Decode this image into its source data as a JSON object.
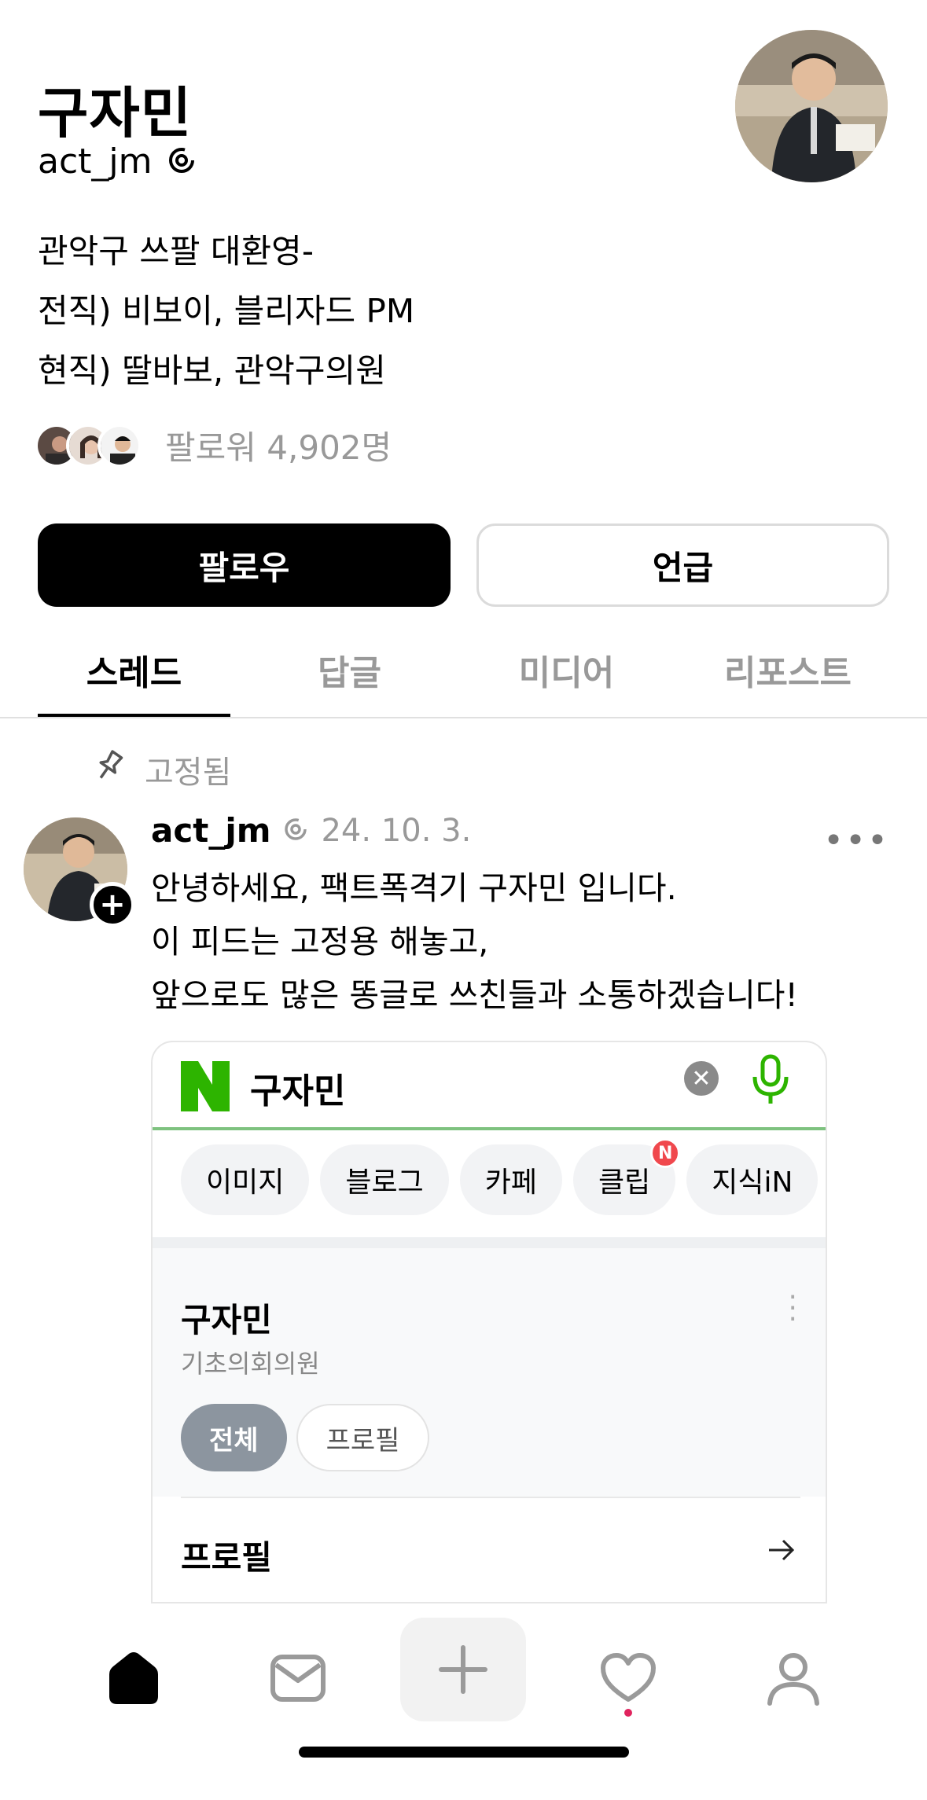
{
  "profile": {
    "name": "구자민",
    "handle": "act_jm",
    "bio": [
      "관악구 쓰팔 대환영-",
      "전직) 비보이, 블리자드 PM",
      "현직) 딸바보, 관악구의원"
    ],
    "followers_text": "팔로워 4,902명",
    "follow_label": "팔로우",
    "mention_label": "언급"
  },
  "tabs": [
    "스레드",
    "답글",
    "미디어",
    "리포스트"
  ],
  "post": {
    "pinned_label": "고정됨",
    "handle": "act_jm",
    "date": "24. 10. 3.",
    "more": "•••",
    "body": [
      "안녕하세요, 팩트폭격기 구자민 입니다.",
      "이 피드는 고정용 해놓고,",
      "앞으로도 많은 똥글로 쓰친들과 소통하겠습니다!"
    ]
  },
  "card": {
    "search_query": "구자민",
    "chips": [
      "이미지",
      "블로그",
      "카페",
      "클립",
      "지식iN"
    ],
    "clip_badge": "N",
    "result_name": "구자민",
    "result_desc": "기초의회의원",
    "filters": [
      "전체",
      "프로필"
    ],
    "section_label": "프로필"
  },
  "colors": {
    "naver_green": "#2db400",
    "badge_red": "#f0484d",
    "muted_gray": "#999999"
  },
  "icons": {
    "verified": "verified-badge-icon",
    "pin": "pin-icon",
    "nav": [
      "home-icon",
      "messages-icon",
      "compose-icon",
      "activity-heart-icon",
      "profile-icon"
    ]
  }
}
